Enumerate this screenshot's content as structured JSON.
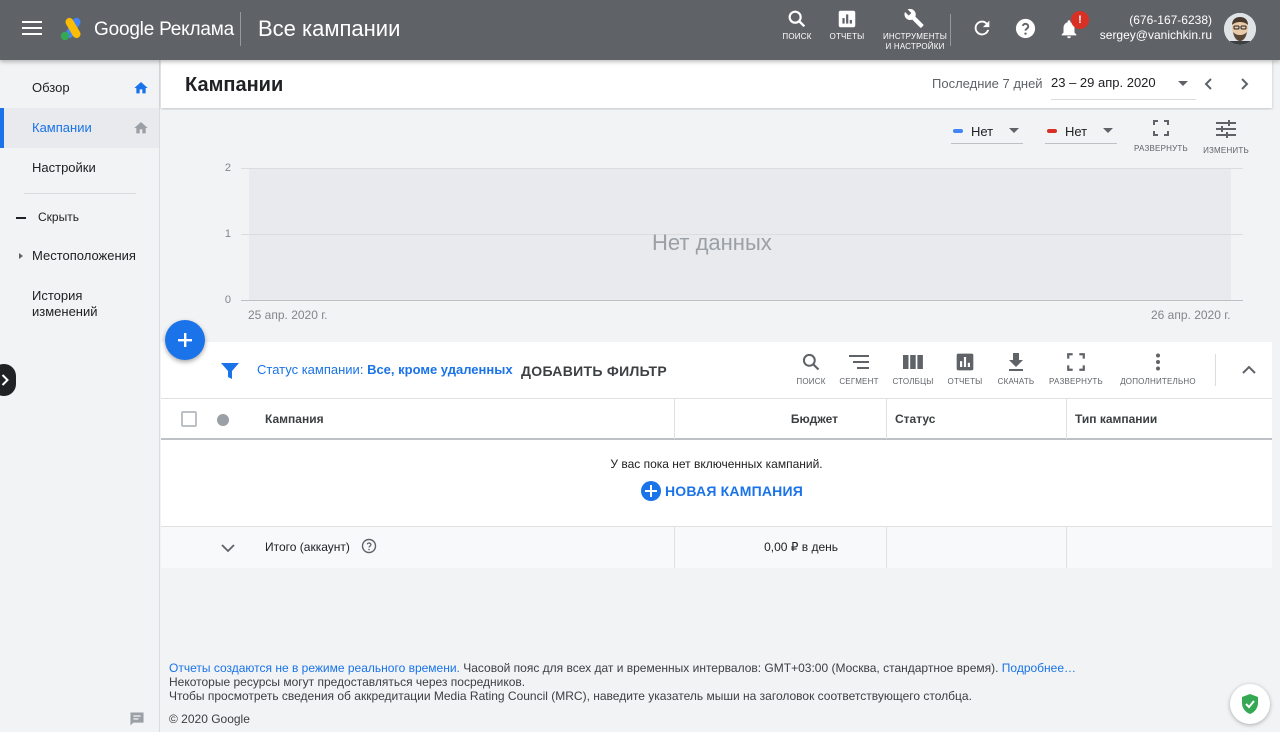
{
  "topbar": {
    "brand": "Google Реклама",
    "page_heading": "Все кампании",
    "buttons": {
      "search": "ПОИСК",
      "reports": "ОТЧЕТЫ",
      "tools_line1": "ИНСТРУМЕНТЫ",
      "tools_line2": "И НАСТРОЙКИ"
    },
    "notification_badge": "!",
    "account": {
      "phone": "(676-167-6238)",
      "email": "sergey@vanichkin.ru"
    }
  },
  "sidebar": {
    "items": [
      {
        "label": "Обзор"
      },
      {
        "label": "Кампании"
      },
      {
        "label": "Настройки"
      }
    ],
    "hide_label": "Скрыть",
    "locations_label": "Местоположения",
    "history_label": "История изменений"
  },
  "header": {
    "title": "Кампании",
    "date_range_label": "Последние 7 дней",
    "date_range_value": "23 – 29 апр. 2020"
  },
  "chart_controls": {
    "metric1": {
      "label": "Нет",
      "color": "#4285f4"
    },
    "metric2": {
      "label": "Нет",
      "color": "#d93025"
    },
    "expand": "РАЗВЕРНУТЬ",
    "edit": "ИЗМЕНИТЬ"
  },
  "chart_data": {
    "type": "line",
    "x": [],
    "series": [],
    "y_ticks": [
      "0",
      "1",
      "2"
    ],
    "x_tick_labels": [
      "25 апр. 2020 г.",
      "26 апр. 2020 г."
    ],
    "ylim": [
      0,
      2
    ],
    "grid": true,
    "no_data_text": "Нет данных"
  },
  "filter": {
    "prefix": "Статус кампании:",
    "value": "Все, кроме удаленных",
    "add_filter": "ДОБАВИТЬ ФИЛЬТР"
  },
  "toolbar": {
    "search": "ПОИСК",
    "segment": "СЕГМЕНТ",
    "columns": "СТОЛБЦЫ",
    "reports": "ОТЧЕТЫ",
    "download": "СКАЧАТЬ",
    "expand": "РАЗВЕРНУТЬ",
    "more": "ДОПОЛНИТЕЛЬНО"
  },
  "table": {
    "columns": [
      "Кампания",
      "Бюджет",
      "Статус",
      "Тип кампании"
    ],
    "empty_text": "У вас пока нет включенных кампаний.",
    "new_campaign": "НОВАЯ КАМПАНИЯ",
    "total_label": "Итого (аккаунт)",
    "total_budget": "0,00 ₽ в день"
  },
  "footer": {
    "line1_link": "Отчеты создаются не в режиме реального времени.",
    "line1_text": " Часовой пояс для всех дат и временных интервалов: GMT+03:00 (Москва, стандартное время). ",
    "line1_more": "Подробнее…",
    "line2": "Некоторые ресурсы могут предоставляться через посредников.",
    "line3": "Чтобы просмотреть сведения об аккредитации Media Rating Council (MRC), наведите указатель мыши на заголовок соответствующего столбца.",
    "copyright": "© 2020 Google"
  }
}
